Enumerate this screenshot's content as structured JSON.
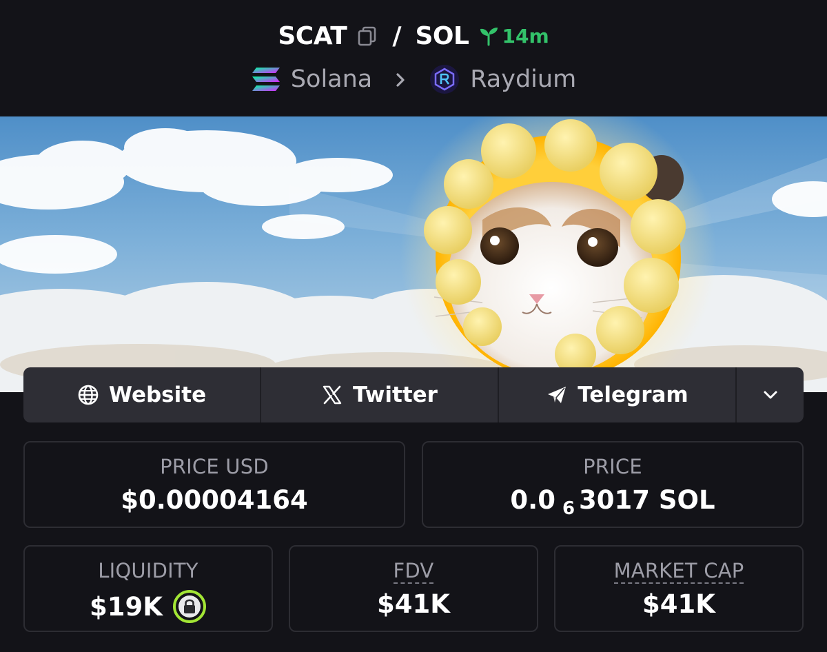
{
  "header": {
    "base_symbol": "SCAT",
    "separator": "/",
    "quote_symbol": "SOL",
    "age": "14m",
    "chain": "Solana",
    "dex": "Raydium"
  },
  "icons": {
    "copy": "copy-icon",
    "age": "sprout-icon",
    "chain": "solana-logo-icon",
    "breadcrumb": "chevron-right-icon",
    "dex": "raydium-logo-icon",
    "website": "globe-icon",
    "twitter": "x-logo-icon",
    "telegram": "paper-plane-icon",
    "more": "chevron-down-icon",
    "liquidity_lock": "lock-icon"
  },
  "socials": {
    "website_label": "Website",
    "twitter_label": "Twitter",
    "telegram_label": "Telegram"
  },
  "stats": {
    "price_usd": {
      "label": "PRICE USD",
      "value": "$0.00004164"
    },
    "price": {
      "label": "PRICE",
      "value_prefix": "0.0",
      "value_zeros": "6",
      "value_suffix": "3017 SOL"
    },
    "liquidity": {
      "label": "LIQUIDITY",
      "value": "$19K"
    },
    "fdv": {
      "label": "FDV",
      "value": "$41K"
    },
    "market_cap": {
      "label": "MARKET CAP",
      "value": "$41K"
    }
  },
  "colors": {
    "background": "#131318",
    "accent_green": "#33c26a",
    "muted_text": "#a9a9b2",
    "social_bar": "#2e2e35",
    "lock_ring": "#a3e635"
  }
}
